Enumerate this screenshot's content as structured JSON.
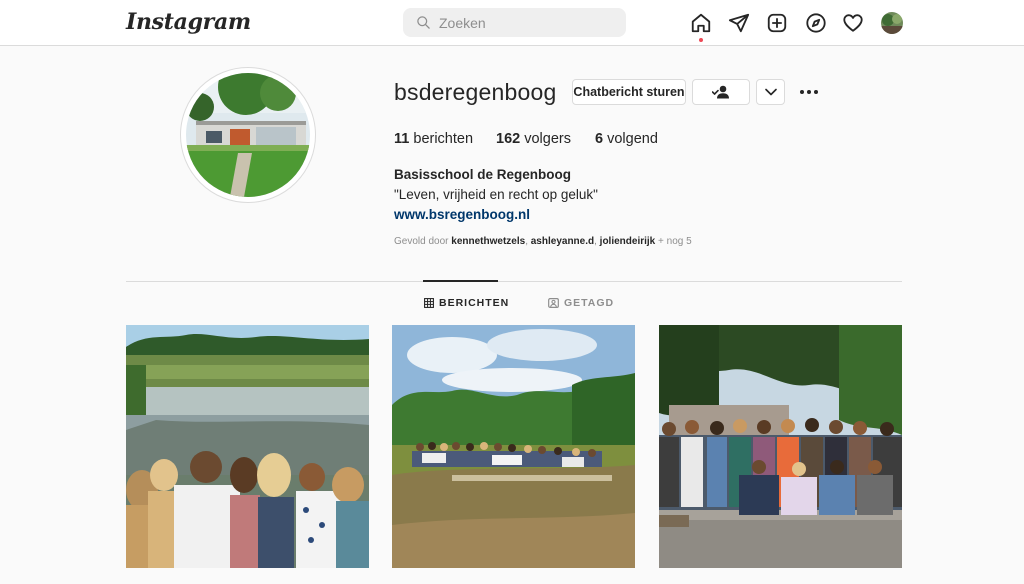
{
  "app": {
    "logo_text": "Instagram"
  },
  "search": {
    "placeholder": "Zoeken",
    "value": ""
  },
  "nav": {
    "icons": [
      "home-icon",
      "direct-message-icon",
      "new-post-icon",
      "explore-icon",
      "activity-heart-icon",
      "profile-avatar"
    ]
  },
  "profile": {
    "username": "bsderegenboog",
    "buttons": {
      "message": "Chatbericht sturen"
    },
    "stats": {
      "posts_count": "11",
      "posts_label": "berichten",
      "followers_count": "162",
      "followers_label": "volgers",
      "following_count": "6",
      "following_label": "volgend"
    },
    "full_name": "Basisschool de Regenboog",
    "bio": "\"Leven, vrijheid en recht op geluk\"",
    "website": "www.bsregenboog.nl",
    "followed_by": {
      "prefix": "Gevold door",
      "accounts": [
        "kennethwetzels",
        "ashleyanne.d",
        "joliendeirijk"
      ],
      "suffix": "+ nog 5"
    }
  },
  "tabs": {
    "posts": "BERICHTEN",
    "tagged": "GETAGD",
    "active": "posts"
  },
  "colors": {
    "link": "#00376b",
    "notification_dot": "#ed4956",
    "border": "#dbdbdb"
  }
}
